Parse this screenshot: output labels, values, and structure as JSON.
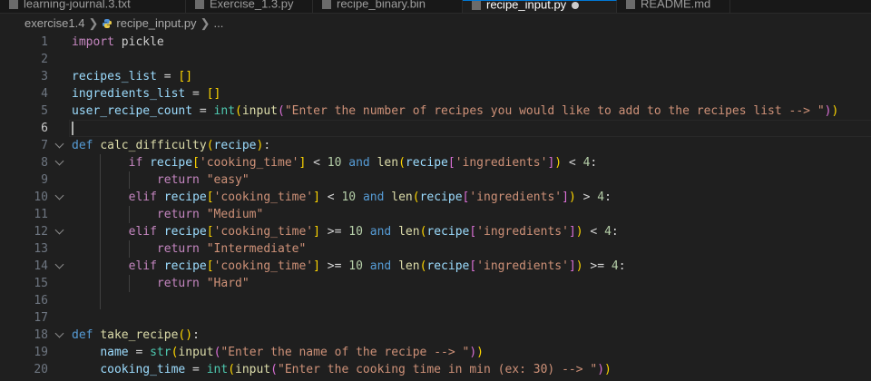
{
  "tabs": [
    {
      "label": "learning-journal.3.txt",
      "active": false
    },
    {
      "label": "Exercise_1.3.py",
      "active": false
    },
    {
      "label": "recipe_binary.bin",
      "active": false
    },
    {
      "label": "recipe_input.py",
      "active": true
    },
    {
      "label": "README.md",
      "active": false
    }
  ],
  "breadcrumb": {
    "folder": "exercise1.4",
    "file": "recipe_input.py",
    "more": "..."
  },
  "editor": {
    "current_line": 6,
    "lines": [
      {
        "n": "1",
        "tokens": [
          {
            "t": "import",
            "c": "ctrl"
          },
          {
            "t": " pickle",
            "c": "txt"
          }
        ]
      },
      {
        "n": "2",
        "tokens": []
      },
      {
        "n": "3",
        "tokens": [
          {
            "t": "recipes_list",
            "c": "var"
          },
          {
            "t": " = ",
            "c": "op"
          },
          {
            "t": "[]",
            "c": "b1"
          }
        ]
      },
      {
        "n": "4",
        "tokens": [
          {
            "t": "ingredients_list",
            "c": "var"
          },
          {
            "t": " = ",
            "c": "op"
          },
          {
            "t": "[]",
            "c": "b1"
          }
        ]
      },
      {
        "n": "5",
        "tokens": [
          {
            "t": "user_recipe_count",
            "c": "var"
          },
          {
            "t": " = ",
            "c": "op"
          },
          {
            "t": "int",
            "c": "cls"
          },
          {
            "t": "(",
            "c": "b1"
          },
          {
            "t": "input",
            "c": "fn"
          },
          {
            "t": "(",
            "c": "b2"
          },
          {
            "t": "\"Enter the number of recipes you would like to add to the recipes list --> \"",
            "c": "str"
          },
          {
            "t": ")",
            "c": "b2"
          },
          {
            "t": ")",
            "c": "b1"
          }
        ]
      },
      {
        "n": "6",
        "tokens": []
      },
      {
        "n": "7",
        "fold": true,
        "tokens": [
          {
            "t": "def",
            "c": "kw"
          },
          {
            "t": " ",
            "c": "txt"
          },
          {
            "t": "calc_difficulty",
            "c": "fn"
          },
          {
            "t": "(",
            "c": "b1"
          },
          {
            "t": "recipe",
            "c": "var"
          },
          {
            "t": ")",
            "c": "b1"
          },
          {
            "t": ":",
            "c": "op"
          }
        ]
      },
      {
        "n": "8",
        "fold": true,
        "tokens": [
          {
            "t": "        ",
            "c": "txt"
          },
          {
            "t": "if",
            "c": "ctrl"
          },
          {
            "t": " ",
            "c": "txt"
          },
          {
            "t": "recipe",
            "c": "var"
          },
          {
            "t": "[",
            "c": "b1"
          },
          {
            "t": "'cooking_time'",
            "c": "str"
          },
          {
            "t": "]",
            "c": "b1"
          },
          {
            "t": " < ",
            "c": "op"
          },
          {
            "t": "10",
            "c": "num"
          },
          {
            "t": " ",
            "c": "txt"
          },
          {
            "t": "and",
            "c": "kw"
          },
          {
            "t": " ",
            "c": "txt"
          },
          {
            "t": "len",
            "c": "fn"
          },
          {
            "t": "(",
            "c": "b1"
          },
          {
            "t": "recipe",
            "c": "var"
          },
          {
            "t": "[",
            "c": "b2"
          },
          {
            "t": "'ingredients'",
            "c": "str"
          },
          {
            "t": "]",
            "c": "b2"
          },
          {
            "t": ")",
            "c": "b1"
          },
          {
            "t": " < ",
            "c": "op"
          },
          {
            "t": "4",
            "c": "num"
          },
          {
            "t": ":",
            "c": "op"
          }
        ]
      },
      {
        "n": "9",
        "tokens": [
          {
            "t": "            ",
            "c": "txt"
          },
          {
            "t": "return",
            "c": "ctrl"
          },
          {
            "t": " ",
            "c": "txt"
          },
          {
            "t": "\"easy\"",
            "c": "str"
          }
        ]
      },
      {
        "n": "10",
        "fold": true,
        "tokens": [
          {
            "t": "        ",
            "c": "txt"
          },
          {
            "t": "elif",
            "c": "ctrl"
          },
          {
            "t": " ",
            "c": "txt"
          },
          {
            "t": "recipe",
            "c": "var"
          },
          {
            "t": "[",
            "c": "b1"
          },
          {
            "t": "'cooking_time'",
            "c": "str"
          },
          {
            "t": "]",
            "c": "b1"
          },
          {
            "t": " < ",
            "c": "op"
          },
          {
            "t": "10",
            "c": "num"
          },
          {
            "t": " ",
            "c": "txt"
          },
          {
            "t": "and",
            "c": "kw"
          },
          {
            "t": " ",
            "c": "txt"
          },
          {
            "t": "len",
            "c": "fn"
          },
          {
            "t": "(",
            "c": "b1"
          },
          {
            "t": "recipe",
            "c": "var"
          },
          {
            "t": "[",
            "c": "b2"
          },
          {
            "t": "'ingredients'",
            "c": "str"
          },
          {
            "t": "]",
            "c": "b2"
          },
          {
            "t": ")",
            "c": "b1"
          },
          {
            "t": " > ",
            "c": "op"
          },
          {
            "t": "4",
            "c": "num"
          },
          {
            "t": ":",
            "c": "op"
          }
        ]
      },
      {
        "n": "11",
        "tokens": [
          {
            "t": "            ",
            "c": "txt"
          },
          {
            "t": "return",
            "c": "ctrl"
          },
          {
            "t": " ",
            "c": "txt"
          },
          {
            "t": "\"Medium\"",
            "c": "str"
          }
        ]
      },
      {
        "n": "12",
        "fold": true,
        "tokens": [
          {
            "t": "        ",
            "c": "txt"
          },
          {
            "t": "elif",
            "c": "ctrl"
          },
          {
            "t": " ",
            "c": "txt"
          },
          {
            "t": "recipe",
            "c": "var"
          },
          {
            "t": "[",
            "c": "b1"
          },
          {
            "t": "'cooking_time'",
            "c": "str"
          },
          {
            "t": "]",
            "c": "b1"
          },
          {
            "t": " >= ",
            "c": "op"
          },
          {
            "t": "10",
            "c": "num"
          },
          {
            "t": " ",
            "c": "txt"
          },
          {
            "t": "and",
            "c": "kw"
          },
          {
            "t": " ",
            "c": "txt"
          },
          {
            "t": "len",
            "c": "fn"
          },
          {
            "t": "(",
            "c": "b1"
          },
          {
            "t": "recipe",
            "c": "var"
          },
          {
            "t": "[",
            "c": "b2"
          },
          {
            "t": "'ingredients'",
            "c": "str"
          },
          {
            "t": "]",
            "c": "b2"
          },
          {
            "t": ")",
            "c": "b1"
          },
          {
            "t": " < ",
            "c": "op"
          },
          {
            "t": "4",
            "c": "num"
          },
          {
            "t": ":",
            "c": "op"
          }
        ]
      },
      {
        "n": "13",
        "tokens": [
          {
            "t": "            ",
            "c": "txt"
          },
          {
            "t": "return",
            "c": "ctrl"
          },
          {
            "t": " ",
            "c": "txt"
          },
          {
            "t": "\"Intermediate\"",
            "c": "str"
          }
        ]
      },
      {
        "n": "14",
        "fold": true,
        "tokens": [
          {
            "t": "        ",
            "c": "txt"
          },
          {
            "t": "elif",
            "c": "ctrl"
          },
          {
            "t": " ",
            "c": "txt"
          },
          {
            "t": "recipe",
            "c": "var"
          },
          {
            "t": "[",
            "c": "b1"
          },
          {
            "t": "'cooking_time'",
            "c": "str"
          },
          {
            "t": "]",
            "c": "b1"
          },
          {
            "t": " >= ",
            "c": "op"
          },
          {
            "t": "10",
            "c": "num"
          },
          {
            "t": " ",
            "c": "txt"
          },
          {
            "t": "and",
            "c": "kw"
          },
          {
            "t": " ",
            "c": "txt"
          },
          {
            "t": "len",
            "c": "fn"
          },
          {
            "t": "(",
            "c": "b1"
          },
          {
            "t": "recipe",
            "c": "var"
          },
          {
            "t": "[",
            "c": "b2"
          },
          {
            "t": "'ingredients'",
            "c": "str"
          },
          {
            "t": "]",
            "c": "b2"
          },
          {
            "t": ")",
            "c": "b1"
          },
          {
            "t": " >= ",
            "c": "op"
          },
          {
            "t": "4",
            "c": "num"
          },
          {
            "t": ":",
            "c": "op"
          }
        ]
      },
      {
        "n": "15",
        "tokens": [
          {
            "t": "            ",
            "c": "txt"
          },
          {
            "t": "return",
            "c": "ctrl"
          },
          {
            "t": " ",
            "c": "txt"
          },
          {
            "t": "\"Hard\"",
            "c": "str"
          }
        ]
      },
      {
        "n": "16",
        "tokens": []
      },
      {
        "n": "17",
        "tokens": []
      },
      {
        "n": "18",
        "fold": true,
        "tokens": [
          {
            "t": "def",
            "c": "kw"
          },
          {
            "t": " ",
            "c": "txt"
          },
          {
            "t": "take_recipe",
            "c": "fn"
          },
          {
            "t": "()",
            "c": "b1"
          },
          {
            "t": ":",
            "c": "op"
          }
        ]
      },
      {
        "n": "19",
        "tokens": [
          {
            "t": "    ",
            "c": "txt"
          },
          {
            "t": "name",
            "c": "var"
          },
          {
            "t": " = ",
            "c": "op"
          },
          {
            "t": "str",
            "c": "cls"
          },
          {
            "t": "(",
            "c": "b1"
          },
          {
            "t": "input",
            "c": "fn"
          },
          {
            "t": "(",
            "c": "b2"
          },
          {
            "t": "\"Enter the name of the recipe --> \"",
            "c": "str"
          },
          {
            "t": ")",
            "c": "b2"
          },
          {
            "t": ")",
            "c": "b1"
          }
        ]
      },
      {
        "n": "20",
        "tokens": [
          {
            "t": "    ",
            "c": "txt"
          },
          {
            "t": "cooking_time",
            "c": "var"
          },
          {
            "t": " = ",
            "c": "op"
          },
          {
            "t": "int",
            "c": "cls"
          },
          {
            "t": "(",
            "c": "b1"
          },
          {
            "t": "input",
            "c": "fn"
          },
          {
            "t": "(",
            "c": "b2"
          },
          {
            "t": "\"Enter the cooking time in min (ex: 30) --> \"",
            "c": "str"
          },
          {
            "t": ")",
            "c": "b2"
          },
          {
            "t": ")",
            "c": "b1"
          }
        ]
      }
    ]
  }
}
